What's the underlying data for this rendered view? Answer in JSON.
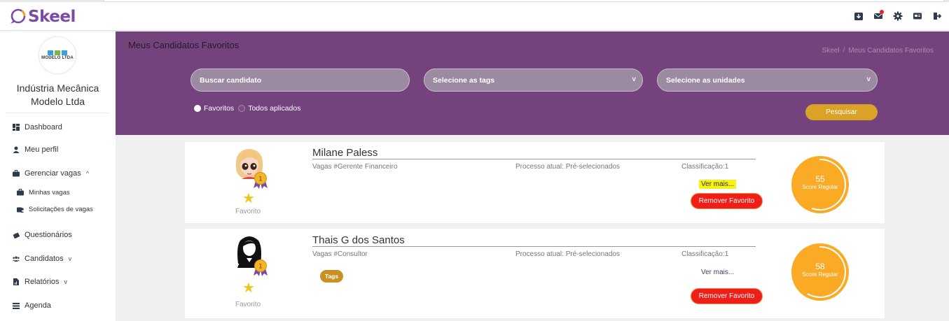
{
  "app": {
    "logo_text": "Skeel"
  },
  "header": {
    "icons": [
      "download-icon",
      "mail-icon",
      "gear-icon",
      "card-icon",
      "logout-icon"
    ]
  },
  "sidebar": {
    "company_brand": "MODELO LTDA",
    "company_name": "Indústria Mecânica Modelo Ltda",
    "items": [
      {
        "label": "Dashboard",
        "icon": "dashboard-icon"
      },
      {
        "label": "Meu perfil",
        "icon": "user-icon"
      },
      {
        "label": "Gerenciar vagas",
        "icon": "briefcase-icon",
        "chevron": "^"
      },
      {
        "label": "Minhas vagas",
        "icon": "briefcase-icon"
      },
      {
        "label": "Solicitações de vagas",
        "icon": "briefcase-user-icon"
      },
      {
        "label": "Questionários",
        "icon": "puzzle-icon"
      },
      {
        "label": "Candidatos",
        "icon": "users-icon",
        "chevron": "v"
      },
      {
        "label": "Relatórios",
        "icon": "report-icon",
        "chevron": "v"
      },
      {
        "label": "Agenda",
        "icon": "list-icon"
      }
    ]
  },
  "page": {
    "title": "Meus Candidatos Favoritos",
    "breadcrumb": [
      "Skeel",
      "/",
      "Meus Candidatos Favoritos"
    ]
  },
  "filters": {
    "search_placeholder": "Buscar candidato",
    "tags_placeholder": "Selecione as tags",
    "units_placeholder": "Selecione as unidades",
    "radio_favorites": "Favoritos",
    "radio_all": "Todos aplicados",
    "search_button": "Pesquisar"
  },
  "candidates": [
    {
      "name": "Milane Paless",
      "vagas": "Vagas #Gerente Financeiro",
      "processo": "Processo atual: Pré-selecionados",
      "classificacao": "Classificação:1",
      "ver_mais": "Ver mais...",
      "remove_label": "Remover Favorito",
      "favorite_label": "Favorito",
      "score": "55",
      "score_label": "Score Regular",
      "score_fraction": 0.55,
      "medal": "1"
    },
    {
      "name": "Thais G dos Santos",
      "vagas": "Vagas #Consultor",
      "processo": "Processo atual: Pré-selecionados",
      "classificacao": "Classificação:1",
      "ver_mais": "Ver mais...",
      "remove_label": "Remover Favorito",
      "favorite_label": "Favorito",
      "score": "58",
      "score_label": "Score Regular",
      "score_fraction": 0.58,
      "medal": "1",
      "tag": "Tags"
    }
  ],
  "colors": {
    "banner": "#74437e",
    "accent": "#dba228",
    "remove": "#f01e18",
    "score": "#fbaa25",
    "logo": "#7b4aa5"
  }
}
